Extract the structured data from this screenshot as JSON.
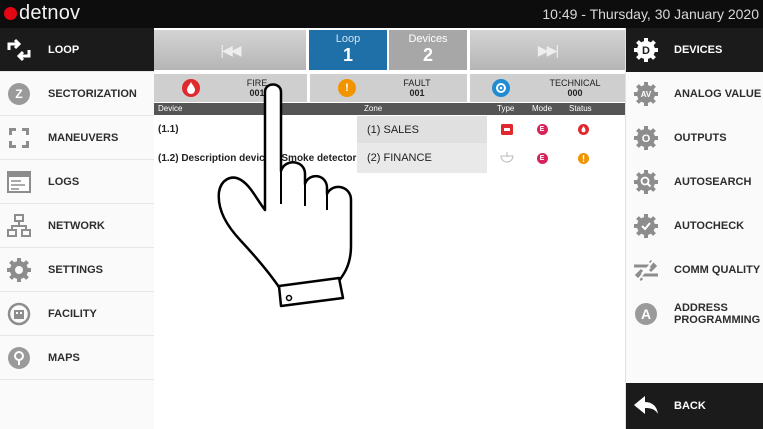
{
  "header": {
    "logo": "detnov",
    "datetime": "10:49  -  Thursday, 30 January 2020"
  },
  "left_nav": [
    {
      "label": "LOOP",
      "icon": "loop-arrows-icon",
      "active": true
    },
    {
      "label": "SECTORIZATION",
      "icon": "sectorization-pin-icon"
    },
    {
      "label": "MANEUVERS",
      "icon": "maneuvers-arrows-icon"
    },
    {
      "label": "LOGS",
      "icon": "logs-window-icon"
    },
    {
      "label": "NETWORK",
      "icon": "network-icon"
    },
    {
      "label": "SETTINGS",
      "icon": "settings-gear-icon"
    },
    {
      "label": "FACILITY",
      "icon": "facility-building-icon"
    },
    {
      "label": "MAPS",
      "icon": "maps-pin-icon"
    }
  ],
  "right_nav": [
    {
      "label": "DEVICES",
      "icon": "devices-gear-icon",
      "active": true
    },
    {
      "label": "ANALOG VALUE",
      "icon": "analog-value-gear-icon"
    },
    {
      "label": "OUTPUTS",
      "icon": "outputs-gear-icon"
    },
    {
      "label": "AUTOSEARCH",
      "icon": "autosearch-gear-icon"
    },
    {
      "label": "AUTOCHECK",
      "icon": "autocheck-gear-icon"
    },
    {
      "label": "COMM QUALITY",
      "icon": "comm-quality-arrows-icon"
    },
    {
      "label": "ADDRESS PROGRAMMING",
      "icon": "address-programming-icon"
    },
    {
      "label": "BACK",
      "icon": "back-arrow-icon",
      "active": true
    }
  ],
  "loop_bar": {
    "prev_icon": "skip-back-icon",
    "loop_label": "Loop",
    "loop_value": "1",
    "devices_label": "Devices",
    "devices_value": "2",
    "next_icon": "skip-forward-icon"
  },
  "counters": {
    "fire": {
      "label": "FIRE",
      "value": "001",
      "color": "#e0292f",
      "icon": "fire-drop-icon"
    },
    "fault": {
      "label": "FAULT",
      "value": "001",
      "color": "#f29400",
      "icon": "fault-exclamation-icon"
    },
    "technical": {
      "label": "TECHNICAL",
      "value": "000",
      "color": "#1f8bd0",
      "icon": "technical-gear-icon"
    }
  },
  "table": {
    "headers": {
      "device": "Device",
      "zone": "Zone",
      "type": "Type",
      "mode": "Mode",
      "status": "Status"
    },
    "rows": [
      {
        "device": "(1.1)",
        "zone": "(1) SALES",
        "type_icon": "call-point-icon",
        "mode": "E",
        "status_icon": "fire-drop-icon"
      },
      {
        "device": "(1.2) Description device 2 Smoke detector",
        "zone": "(2) FINANCE",
        "type_icon": "smoke-detector-icon",
        "mode": "E",
        "status_icon": "fault-exclamation-icon"
      }
    ]
  },
  "overlay": {
    "icon": "pointing-hand-icon"
  }
}
